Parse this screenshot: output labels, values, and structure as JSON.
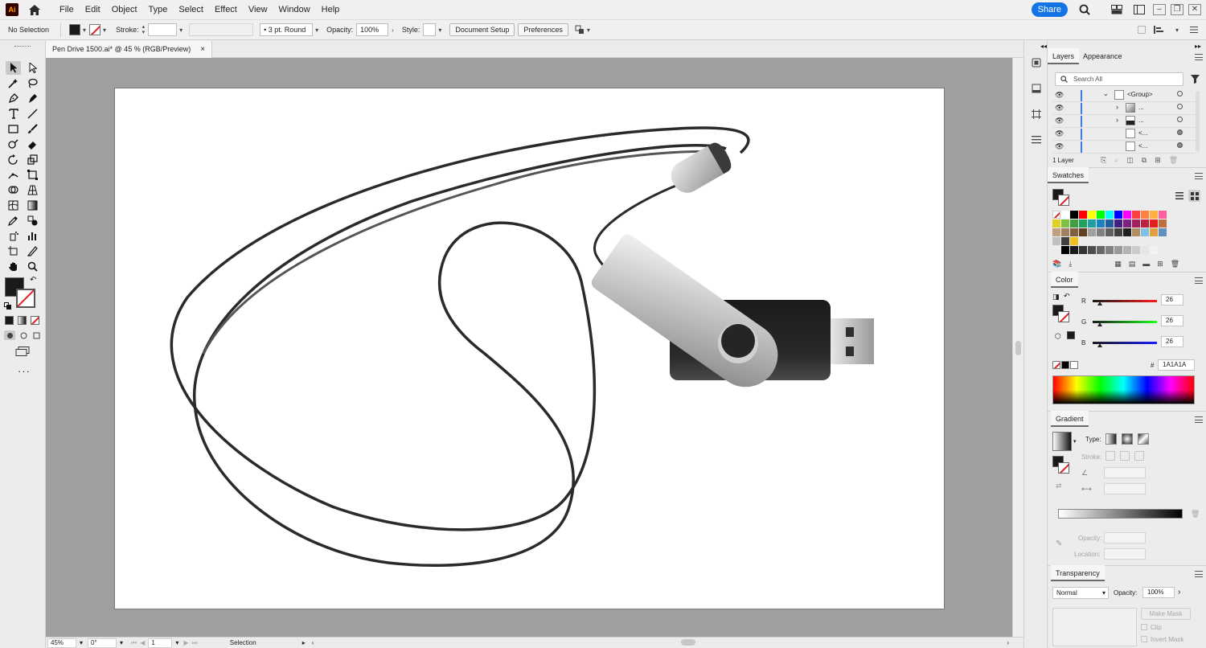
{
  "app": {
    "logo_text": "Ai"
  },
  "menu": {
    "items": [
      "File",
      "Edit",
      "Object",
      "Type",
      "Select",
      "Effect",
      "View",
      "Window",
      "Help"
    ],
    "share_label": "Share"
  },
  "control_bar": {
    "selection_label": "No Selection",
    "stroke_label": "Stroke:",
    "brush_label": "3 pt. Round",
    "opacity_label": "Opacity:",
    "opacity_value": "100%",
    "style_label": "Style:",
    "document_setup_label": "Document Setup",
    "preferences_label": "Preferences"
  },
  "document": {
    "tab_title": "Pen Drive 1500.ai* @ 45 % (RGB/Preview)",
    "close_glyph": "×"
  },
  "status_bar": {
    "zoom": "45%",
    "rotation": "0°",
    "artboard": "1",
    "tool": "Selection"
  },
  "layers_panel": {
    "tabs": [
      "Layers",
      "Appearance"
    ],
    "search_placeholder": "Search All",
    "rows": [
      {
        "name": "<Group>"
      },
      {
        "name": "..."
      },
      {
        "name": "..."
      },
      {
        "name": "<..."
      },
      {
        "name": "<..."
      }
    ],
    "layer_count": "1 Layer"
  },
  "swatches_panel": {
    "title": "Swatches",
    "colors": [
      "#ffffff",
      "#000000",
      "#e53935",
      "#ffeb3b",
      "#4caf50",
      "#00bcd4",
      "#3f51b5",
      "#9c27b0",
      "#ff9800",
      "#795548",
      "#9e9e9e",
      "#1a1a1a"
    ]
  },
  "color_panel": {
    "title": "Color",
    "channels": [
      {
        "label": "R",
        "value": "26",
        "color": "#e02020"
      },
      {
        "label": "G",
        "value": "26",
        "color": "#20b020"
      },
      {
        "label": "B",
        "value": "26",
        "color": "#2030d0"
      }
    ],
    "hex_symbol": "#",
    "hex": "1A1A1A"
  },
  "gradient_panel": {
    "title": "Gradient",
    "type_label": "Type:",
    "stroke_label": "Stroke:",
    "opacity_label": "Opacity:",
    "location_label": "Location:"
  },
  "transparency_panel": {
    "title": "Transparency",
    "blend_mode": "Normal",
    "opacity_label": "Opacity:",
    "opacity_value": "100%",
    "make_mask_label": "Make Mask",
    "clip_label": "Clip",
    "invert_mask_label": "Invert Mask"
  }
}
